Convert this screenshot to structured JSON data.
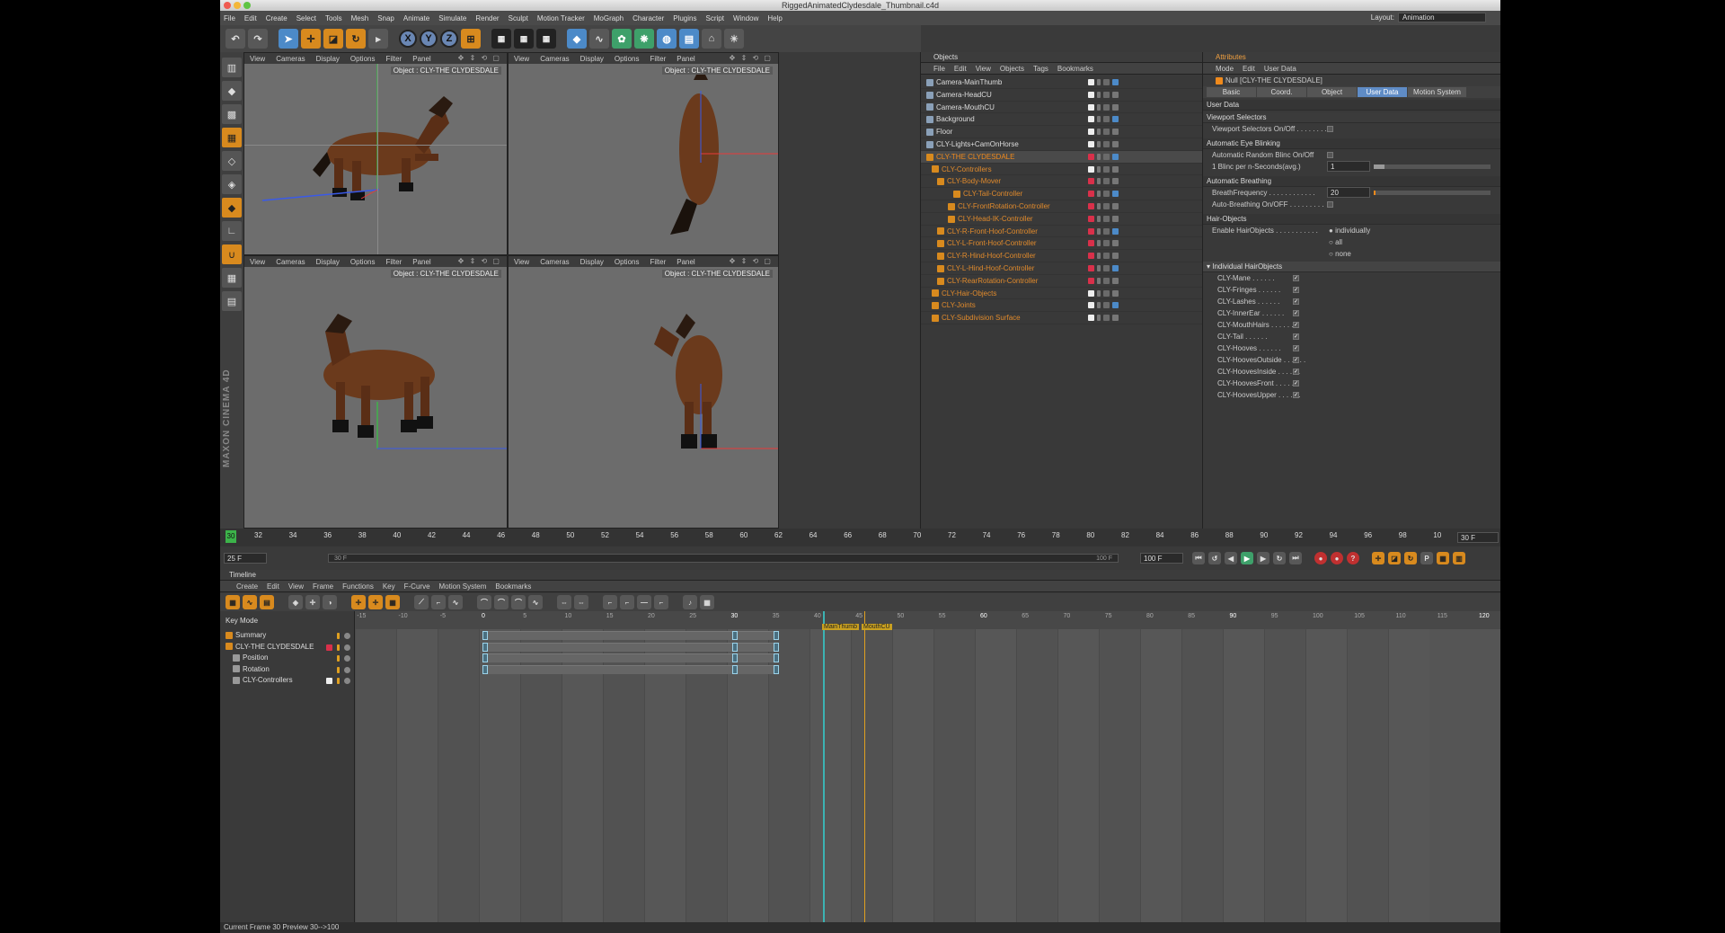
{
  "window": {
    "title": "RiggedAnimatedClydesdale_Thumbnail.c4d"
  },
  "menu": [
    "File",
    "Edit",
    "Create",
    "Select",
    "Tools",
    "Mesh",
    "Snap",
    "Animate",
    "Simulate",
    "Render",
    "Sculpt",
    "Motion Tracker",
    "MoGraph",
    "Character",
    "Plugins",
    "Script",
    "Window",
    "Help"
  ],
  "layout": {
    "label": "Layout:",
    "value": "Animation"
  },
  "viewport_menu": [
    "View",
    "Cameras",
    "Display",
    "Options",
    "Filter",
    "Panel"
  ],
  "viewport_label": "Object : CLY-THE CLYDESDALE",
  "objects_panel": {
    "title": "Objects",
    "menu": [
      "File",
      "Edit",
      "View",
      "Objects",
      "Tags",
      "Bookmarks"
    ],
    "rows": [
      {
        "name": "Camera-MainThumb",
        "indent": 0,
        "color": "#dddddd"
      },
      {
        "name": "Camera-HeadCU",
        "indent": 0,
        "color": "#dddddd"
      },
      {
        "name": "Camera-MouthCU",
        "indent": 0,
        "color": "#dddddd"
      },
      {
        "name": "Background",
        "indent": 0,
        "color": "#dddddd"
      },
      {
        "name": "Floor",
        "indent": 0,
        "color": "#dddddd"
      },
      {
        "name": "CLY-Lights+CamOnHorse",
        "indent": 0,
        "color": "#dddddd"
      },
      {
        "name": "CLY-THE CLYDESDALE",
        "indent": 0,
        "color": "#f08a1c"
      },
      {
        "name": "CLY-Controllers",
        "indent": 1,
        "color": "#e08a2c"
      },
      {
        "name": "CLY-Body-Mover",
        "indent": 2,
        "color": "#e08a2c"
      },
      {
        "name": "CLY-Tail-Controller",
        "indent": 5,
        "color": "#e08a2c"
      },
      {
        "name": "CLY-FrontRotation-Controller",
        "indent": 4,
        "color": "#e08a2c"
      },
      {
        "name": "CLY-Head-IK-Controller",
        "indent": 4,
        "color": "#e08a2c"
      },
      {
        "name": "CLY-R-Front-Hoof-Controller",
        "indent": 2,
        "color": "#e08a2c"
      },
      {
        "name": "CLY-L-Front-Hoof-Controller",
        "indent": 2,
        "color": "#e08a2c"
      },
      {
        "name": "CLY-R-Hind-Hoof-Controller",
        "indent": 2,
        "color": "#e08a2c"
      },
      {
        "name": "CLY-L-Hind-Hoof-Controller",
        "indent": 2,
        "color": "#e08a2c"
      },
      {
        "name": "CLY-RearRotation-Controller",
        "indent": 2,
        "color": "#e08a2c"
      },
      {
        "name": "CLY-Hair-Objects",
        "indent": 1,
        "color": "#e08a2c"
      },
      {
        "name": "CLY-Joints",
        "indent": 1,
        "color": "#e08a2c"
      },
      {
        "name": "CLY-Subdivision Surface",
        "indent": 1,
        "color": "#e08a2c"
      }
    ]
  },
  "attributes": {
    "title": "Attributes",
    "menu": [
      "Mode",
      "Edit",
      "User Data"
    ],
    "object": "Null [CLY-THE CLYDESDALE]",
    "tabs": [
      "Basic",
      "Coord.",
      "Object",
      "User Data",
      "Motion System"
    ],
    "active_tab": "User Data",
    "section_user_data": "User Data",
    "viewport_selectors": "Viewport Selectors",
    "viewport_selectors_toggle": "Viewport Selectors On/Off . . . . . . . . .",
    "eye_blinking": "Automatic Eye Blinking",
    "random_blinc": "Automatic Random Blinc On/Off",
    "blinc_seconds_label": "1 Blinc per n-Seconds(avg.)",
    "blinc_seconds_value": "1",
    "breathing": "Automatic Breathing",
    "breath_freq_label": "BreathFrequency . . . . . . . . . . . .",
    "breath_freq_value": "20",
    "auto_breathing": "Auto-Breathing On/OFF . . . . . . . . .",
    "hair_objects": "Hair-Objects",
    "enable_hair_label": "Enable HairObjects . . . . . . . . . . .",
    "enable_hair_options": [
      "individually",
      "all",
      "none"
    ],
    "individual_hair": "Individual HairObjects",
    "hair_items": [
      "CLY-Mane",
      "CLY-Fringes",
      "CLY-Lashes",
      "CLY-InnerEar",
      "CLY-MouthHairs",
      "CLY-Tail",
      "CLY-Hooves",
      "CLY-HoovesOutside",
      "CLY-HoovesInside",
      "CLY-HoovesFront",
      "CLY-HoovesUpper"
    ],
    "hair_dots": " . . . . . ."
  },
  "time_ruler": {
    "start_label": "30",
    "ticks": [
      "32",
      "34",
      "36",
      "38",
      "40",
      "42",
      "44",
      "46",
      "48",
      "50",
      "52",
      "54",
      "56",
      "58",
      "60",
      "62",
      "64",
      "66",
      "68",
      "70",
      "72",
      "74",
      "76",
      "78",
      "80",
      "82",
      "84",
      "86",
      "88",
      "90",
      "92",
      "94",
      "96",
      "98",
      "10"
    ],
    "end_label": "30 F"
  },
  "transport": {
    "current": "25 F",
    "range_start": "30 F",
    "range_end": "100 F",
    "max": "100 F"
  },
  "timeline": {
    "title": "Timeline",
    "menu": [
      "Create",
      "Edit",
      "View",
      "Frame",
      "Functions",
      "Key",
      "F-Curve",
      "Motion System",
      "Bookmarks"
    ],
    "key_mode": "Key Mode",
    "tracks": [
      {
        "name": "Summary",
        "indent": 0
      },
      {
        "name": "CLY-THE CLYDESDALE",
        "indent": 0
      },
      {
        "name": "Position",
        "indent": 1
      },
      {
        "name": "Rotation",
        "indent": 1
      },
      {
        "name": "CLY-Controllers",
        "indent": 1
      }
    ],
    "ruler": [
      "-15",
      "-10",
      "-5",
      "0",
      "5",
      "10",
      "15",
      "20",
      "25",
      "30",
      "35",
      "40",
      "45",
      "50",
      "55",
      "60",
      "65",
      "70",
      "75",
      "80",
      "85",
      "90",
      "95",
      "100",
      "105",
      "110",
      "115",
      "120"
    ],
    "markers": [
      "MainThumb",
      "MouthCU"
    ]
  },
  "status": "Current Frame  30  Preview  30-->100",
  "colors": {
    "accent": "#5f8cc6",
    "orange": "#f08a1c",
    "red": "#d9304a"
  },
  "brand": "MAXON CINEMA 4D"
}
